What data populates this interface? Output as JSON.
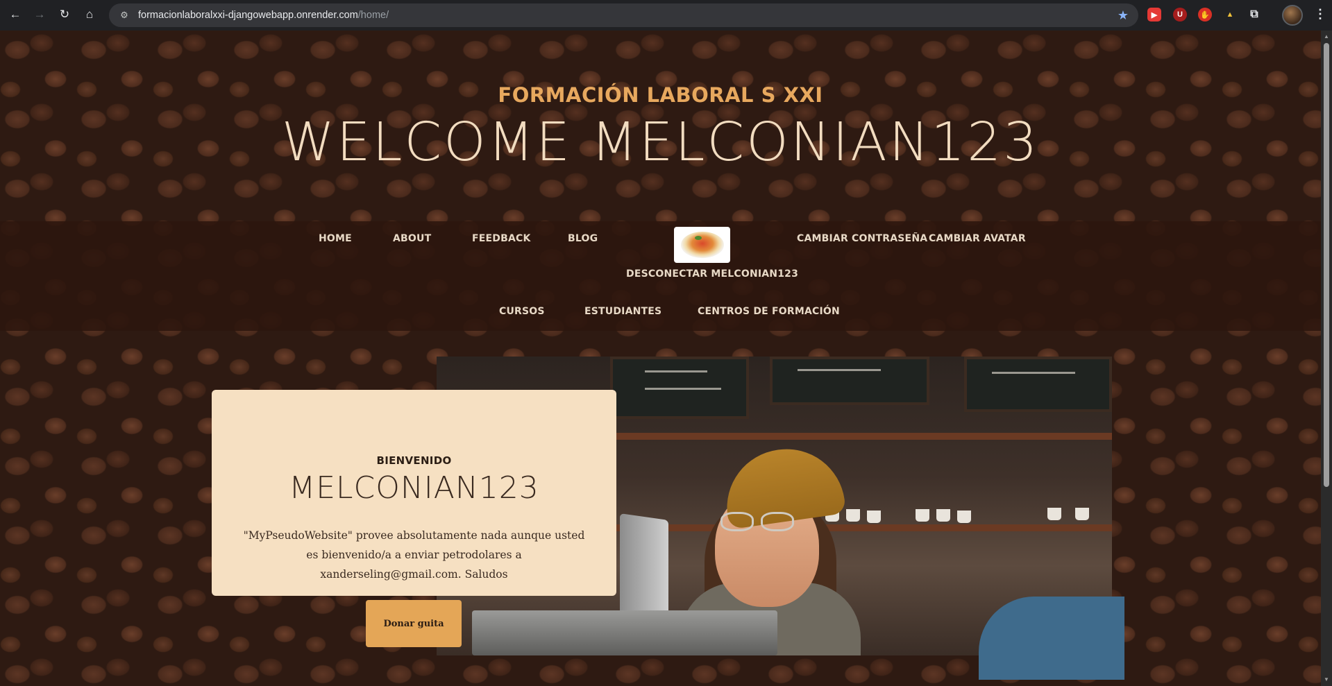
{
  "browser": {
    "url_host": "formacionlaboralxxi-djangowebapp.onrender.com",
    "url_path": "/home/",
    "back_icon": "arrow-left",
    "forward_icon": "arrow-right",
    "reload_icon": "reload",
    "home_icon": "home",
    "extensions": [
      {
        "name": "youtube-ext",
        "label": "▶",
        "color": "#e53935"
      },
      {
        "name": "ublock-ext",
        "label": "U",
        "color": "#a51d1d"
      },
      {
        "name": "hand-ext",
        "label": "✋",
        "color": "#d93025"
      },
      {
        "name": "drive-ext",
        "label": "▲",
        "color": "#f2c23a"
      }
    ]
  },
  "hero": {
    "brand": "FORMACIÓN LABORAL S XXI",
    "welcome": "WELCOME MELCONIAN123"
  },
  "nav": {
    "home": "HOME",
    "about": "ABOUT",
    "feedback": "FEEDBACK",
    "blog": "BLOG",
    "change_password": "CAMBIAR CONTRASEÑA",
    "change_avatar": "CAMBIAR AVATAR",
    "logout": "DESCONECTAR MELCONIAN123",
    "courses": "CURSOS",
    "students": "ESTUDIANTES",
    "centers": "CENTROS DE FORMACIÓN"
  },
  "card": {
    "eyebrow": "BIENVENIDO",
    "title": "MELCONIAN123",
    "text": "\"MyPseudoWebsite\" provee absolutamente nada aunque usted es bienvenido/a a enviar petrodolares a xanderseling@gmail.com. Saludos",
    "button": "Donar guita"
  },
  "colors": {
    "accent": "#e7a85e",
    "nav_bg": "#2c160e",
    "card_bg": "#f6e0c2",
    "button_bg": "#e4a657"
  }
}
